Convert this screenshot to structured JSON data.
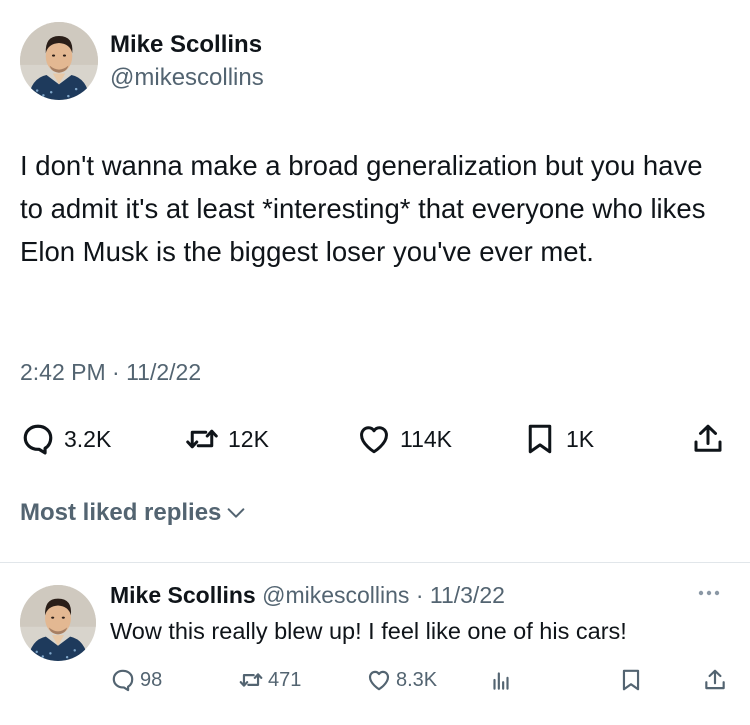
{
  "tweet": {
    "author_name": "Mike Scollins",
    "author_handle": "@mikescollins",
    "text": "I don't wanna make a broad generalization but you have to admit it's at least *interesting* that everyone who likes Elon Musk is the biggest loser you've ever met.",
    "timestamp": "2:42 PM · 11/2/22",
    "stats": {
      "replies": "3.2K",
      "retweets": "12K",
      "likes": "114K",
      "bookmarks": "1K"
    }
  },
  "replies_section": {
    "sort_label": "Most liked replies"
  },
  "reply": {
    "author_name": "Mike Scollins",
    "author_handle": "@mikescollins",
    "date": "· 11/3/22",
    "text": "Wow this really blew up! I feel like one of his cars!",
    "stats": {
      "replies": "98",
      "retweets": "471",
      "likes": "8.3K"
    }
  },
  "icons": {
    "reply": "speech-bubble-icon",
    "retweet": "retweet-arrows-icon",
    "like": "heart-icon",
    "bookmark": "bookmark-icon",
    "share": "share-upload-icon",
    "views": "bar-chart-icon",
    "more": "ellipsis-icon",
    "sort": "chevron-down-icon"
  },
  "colors": {
    "text_primary": "#0f1419",
    "text_secondary": "#536471",
    "divider": "#e1e6ea",
    "background": "#ffffff"
  }
}
